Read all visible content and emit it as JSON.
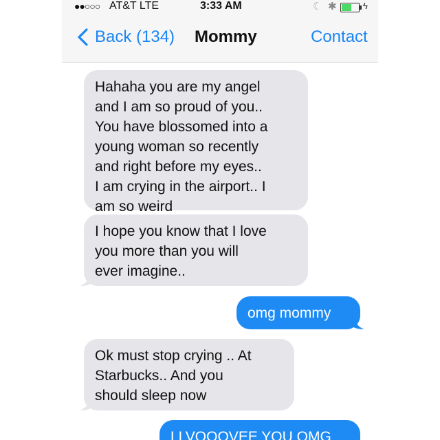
{
  "status_bar": {
    "signal": "●●○○○",
    "carrier": "AT&T  LTE",
    "time": "3:33 AM",
    "moon_icon": "☾",
    "bluetooth_icon": "✱",
    "bolt_icon": "ϟ",
    "battery_level": 0.6
  },
  "nav": {
    "back_label": "Back (134)",
    "title": "Mommy",
    "contact_label": "Contact"
  },
  "colors": {
    "accent": "#1a85f5",
    "sent_bubble": "#1e8bf5",
    "received_bubble": "#e5e5ea"
  },
  "messages": [
    {
      "direction": "received",
      "lines": [
        "Hahaha you are my angel",
        "and I am so proud of you..",
        "You have blossomed into a",
        "young woman so recently",
        "and right before my eyes..",
        "I am crying in the airport.. I",
        "am so weird"
      ]
    },
    {
      "direction": "received",
      "lines": [
        "I hope you know that I love",
        "you more than you will",
        "ever imagine.."
      ]
    },
    {
      "direction": "sent",
      "lines": [
        "omg mommy"
      ]
    },
    {
      "direction": "received",
      "lines": [
        "Ok must stop crying .. At",
        "Starbucks.. And you",
        "should sleep now"
      ]
    },
    {
      "direction": "sent",
      "lines": [
        "LLVOOOVEE YOU OMG"
      ]
    }
  ]
}
